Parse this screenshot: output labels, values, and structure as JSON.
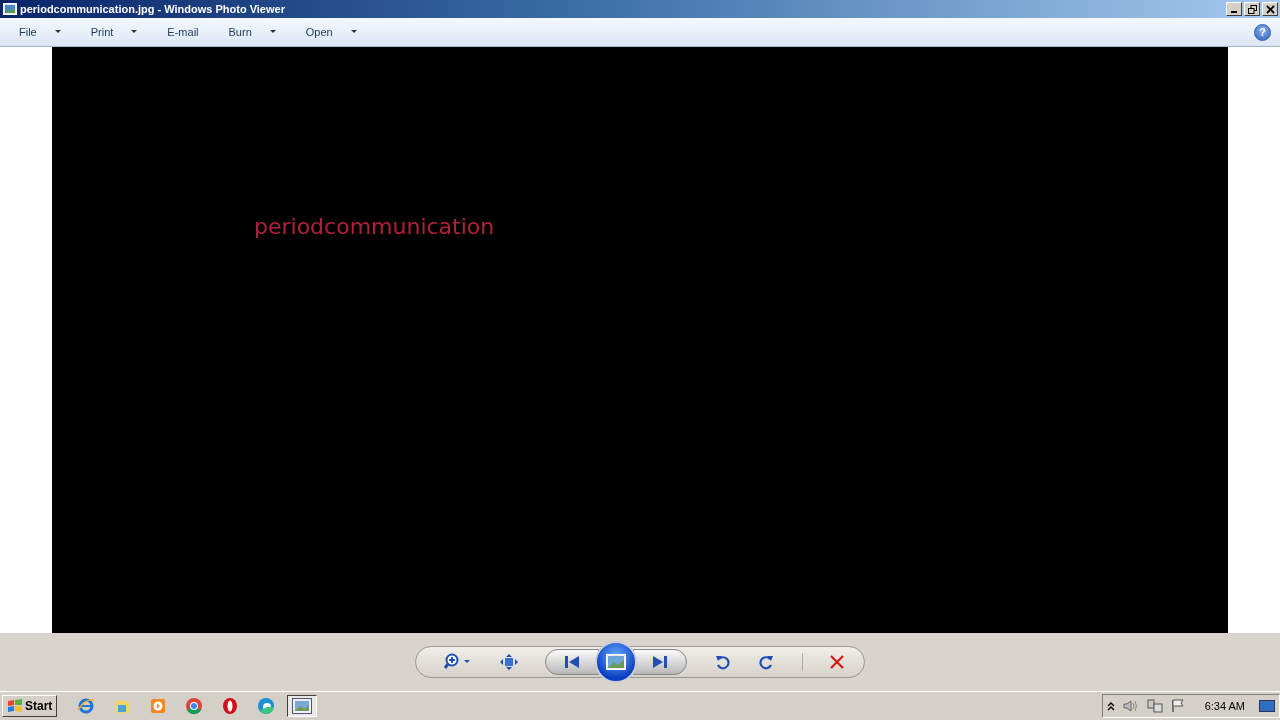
{
  "window": {
    "title": "periodcommunication.jpg - Windows Photo Viewer"
  },
  "menu": [
    {
      "label": "File",
      "dropdown": true
    },
    {
      "label": "Print",
      "dropdown": true
    },
    {
      "label": "E-mail",
      "dropdown": false
    },
    {
      "label": "Burn",
      "dropdown": true
    },
    {
      "label": "Open",
      "dropdown": true
    }
  ],
  "help": "?",
  "image": {
    "text": "periodcommunication"
  },
  "taskbar": {
    "start": "Start",
    "buttons": [
      {
        "selected": false
      },
      {
        "selected": false
      },
      {
        "selected": false
      },
      {
        "selected": false
      },
      {
        "selected": false
      },
      {
        "selected": false
      },
      {
        "selected": true
      }
    ],
    "clock": "6:34 AM"
  }
}
